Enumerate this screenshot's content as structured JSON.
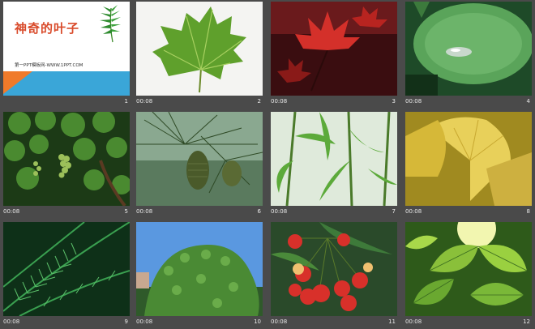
{
  "slides": [
    {
      "title": "神奇的叶子",
      "subtitle": "第一PPT模板网-WWW.1PPT.COM",
      "time": "",
      "num": "1",
      "desc": "title-slide"
    },
    {
      "time": "00:08",
      "num": "2",
      "desc": "maple-leaf-white"
    },
    {
      "time": "00:08",
      "num": "3",
      "desc": "red-maple"
    },
    {
      "time": "00:08",
      "num": "4",
      "desc": "lotus-leaf"
    },
    {
      "time": "00:08",
      "num": "5",
      "desc": "grape-vine"
    },
    {
      "time": "00:08",
      "num": "6",
      "desc": "pine-cone"
    },
    {
      "time": "00:08",
      "num": "7",
      "desc": "bamboo"
    },
    {
      "time": "00:08",
      "num": "8",
      "desc": "ginkgo"
    },
    {
      "time": "00:08",
      "num": "9",
      "desc": "cycad"
    },
    {
      "time": "00:08",
      "num": "10",
      "desc": "ivy-tower"
    },
    {
      "time": "00:08",
      "num": "11",
      "desc": "cherries"
    },
    {
      "time": "00:08",
      "num": "12",
      "desc": "backlit-leaves"
    }
  ],
  "colors": {
    "background": "#4a4a4a",
    "title": "#d94b2b",
    "band_blue": "#3aa6d8",
    "band_orange": "#f07a2a"
  }
}
